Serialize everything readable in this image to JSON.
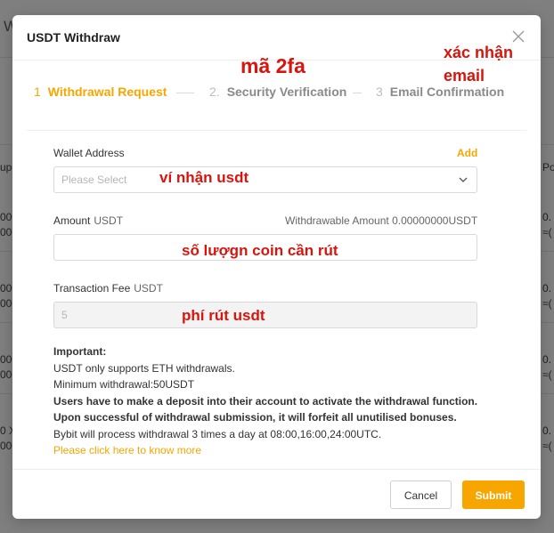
{
  "background": {
    "top_text": "W",
    "left_fragments": [
      "upo",
      "000",
      "00",
      "000",
      "00",
      "000",
      "00",
      "0 X",
      "00"
    ],
    "right_fragments": [
      "Po",
      "0.",
      "≈(",
      "0.",
      "≈(",
      "0.",
      "≈(",
      "0.",
      "≈("
    ]
  },
  "modal": {
    "title": "USDT Withdraw",
    "steps": [
      {
        "num": "1",
        "label": "Withdrawal Request",
        "active": true
      },
      {
        "num": "2.",
        "label": "Security Verification",
        "active": false
      },
      {
        "num": "3",
        "label": "Email Confirmation",
        "active": false
      }
    ],
    "wallet": {
      "label": "Wallet Address",
      "add_label": "Add",
      "placeholder": "Please Select"
    },
    "amount": {
      "label": "Amount",
      "unit": "USDT",
      "withdrawable_label": "Withdrawable Amount",
      "withdrawable_value": "0.00000000USDT",
      "value": ""
    },
    "fee": {
      "label": "Transaction Fee",
      "unit": "USDT",
      "value": "5"
    },
    "notes": {
      "title": "Important:",
      "line1": "USDT only supports ETH withdrawals.",
      "line2": "Minimum withdrawal:50USDT",
      "line3": "Users have to make a deposit into their account to activate the withdrawal function.",
      "line4": "Upon successful of withdrawal submission, it will forfeit all unutilised bonuses.",
      "line5": "Bybit will process withdrawal 3 times a day at 08:00,16:00,24:00UTC.",
      "link": "Please click here to know more"
    },
    "buttons": {
      "cancel": "Cancel",
      "submit": "Submit"
    }
  },
  "annotations": {
    "twofa": "mã 2fa",
    "email_line1": "xác nhận",
    "email_line2": "email",
    "wallet": "ví nhận usdt",
    "amount": "số lượgn coin cần rút",
    "fee": "phí rút usdt"
  },
  "colors": {
    "accent": "#f7a600",
    "annotation": "#d9140d"
  }
}
